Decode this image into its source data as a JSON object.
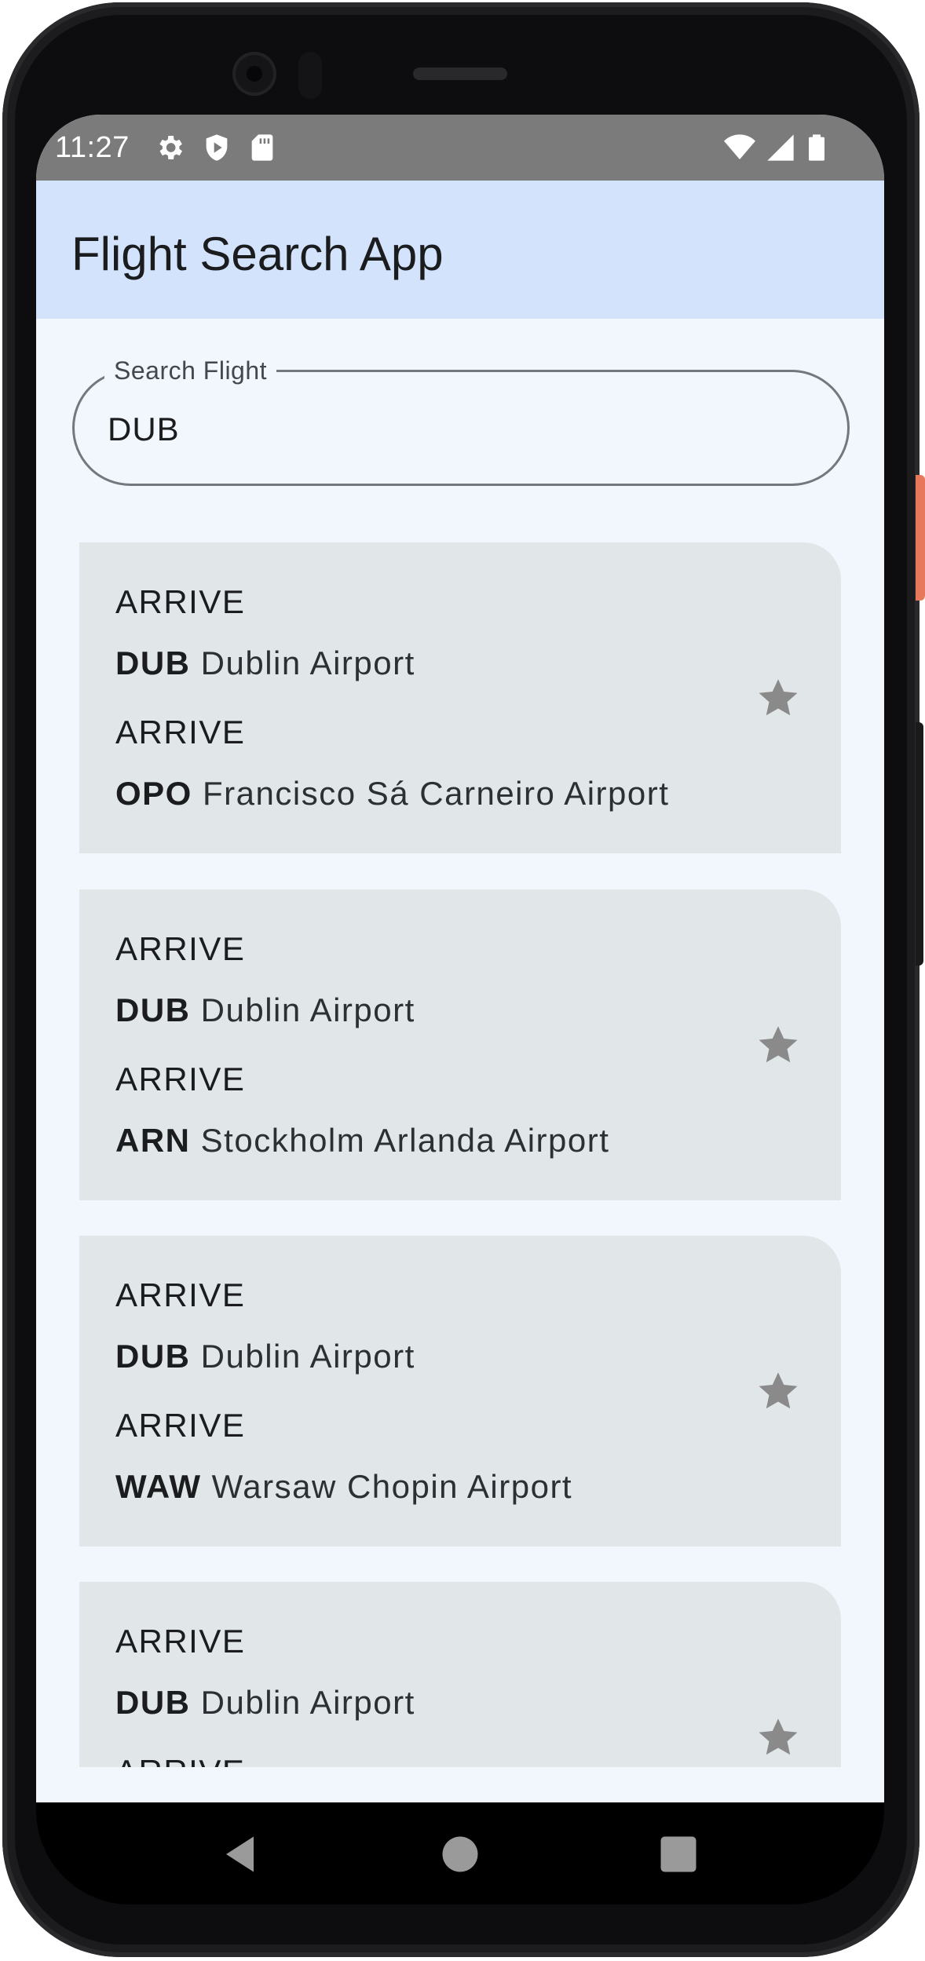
{
  "status_bar": {
    "time": "11:27",
    "left_icons": [
      "settings-icon",
      "shield-play-icon",
      "sd-card-icon"
    ],
    "right_icons": [
      "wifi-icon",
      "signal-icon",
      "battery-icon"
    ]
  },
  "app_bar": {
    "title": "Flight Search App",
    "background": "#d3e3fb"
  },
  "search": {
    "label": "Search Flight",
    "value": "DUB"
  },
  "flights": [
    {
      "from_label": "ARRIVE",
      "from_code": "DUB",
      "from_name": "Dublin Airport",
      "to_label": "ARRIVE",
      "to_code": "OPO",
      "to_name": "Francisco Sá Carneiro Airport",
      "favorite_icon": "star-icon"
    },
    {
      "from_label": "ARRIVE",
      "from_code": "DUB",
      "from_name": "Dublin Airport",
      "to_label": "ARRIVE",
      "to_code": "ARN",
      "to_name": "Stockholm Arlanda Airport",
      "favorite_icon": "star-icon"
    },
    {
      "from_label": "ARRIVE",
      "from_code": "DUB",
      "from_name": "Dublin Airport",
      "to_label": "ARRIVE",
      "to_code": "WAW",
      "to_name": "Warsaw Chopin Airport",
      "favorite_icon": "star-icon"
    },
    {
      "from_label": "ARRIVE",
      "from_code": "DUB",
      "from_name": "Dublin Airport",
      "to_label": "ARRIVE",
      "to_code": "",
      "to_name": "",
      "favorite_icon": "star-icon"
    }
  ],
  "nav_bar": {
    "buttons": [
      "back-icon",
      "home-icon",
      "recents-icon"
    ]
  },
  "colors": {
    "screen_background": "#f1f7fc",
    "card_background": "#e1e7e9",
    "star": "#8a8a8a",
    "status_bar": "#7b7b7b"
  }
}
